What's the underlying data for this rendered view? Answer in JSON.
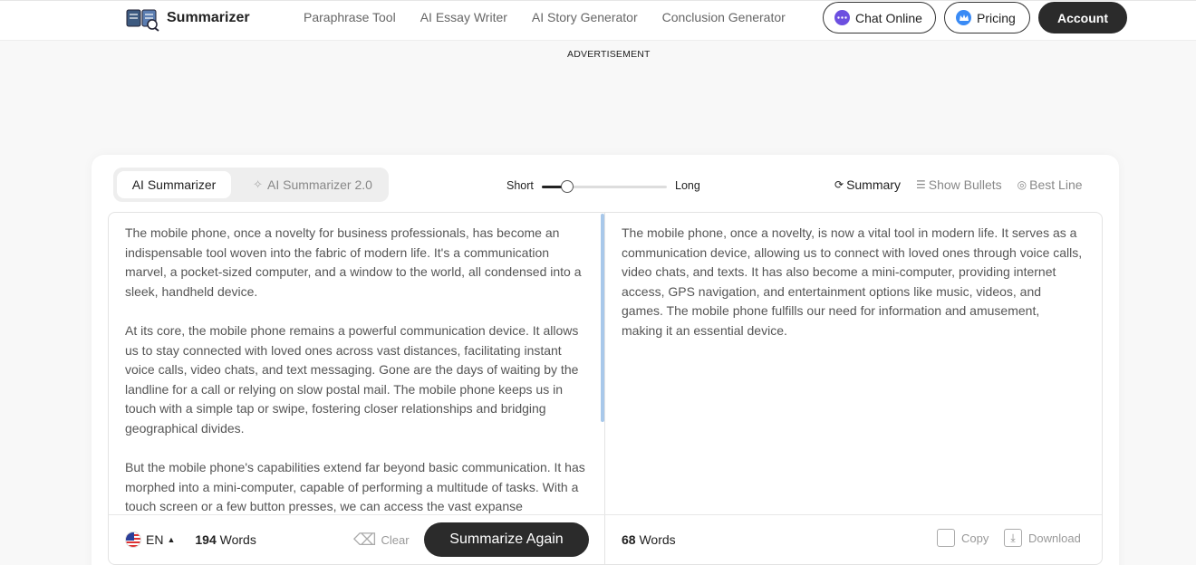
{
  "header": {
    "brand": "Summarizer",
    "nav": [
      "Paraphrase Tool",
      "AI Essay Writer",
      "AI Story Generator",
      "Conclusion Generator"
    ],
    "chat_label": "Chat Online",
    "pricing_label": "Pricing",
    "account_label": "Account"
  },
  "ad_label": "ADVERTISEMENT",
  "tool": {
    "tabs": [
      "AI Summarizer",
      "AI Summarizer 2.0"
    ],
    "length_short": "Short",
    "length_long": "Long",
    "length_level": 0.2,
    "modes": [
      "Summary",
      "Show Bullets",
      "Best Line"
    ],
    "input_paragraphs": [
      "The mobile phone, once a novelty for business professionals, has become an indispensable tool woven into the fabric of modern life. It's a communication marvel, a pocket-sized computer, and a window to the world, all condensed into a sleek, handheld device.",
      "At its core, the mobile phone remains a powerful communication device. It allows us to stay connected with loved ones across vast distances, facilitating instant voice calls, video chats, and text messaging.  Gone are the days of waiting by the landline for a call or relying on slow postal mail. The mobile phone keeps us in touch with a simple tap or swipe, fostering closer relationships and bridging geographical divides.",
      "But the mobile phone's capabilities extend far beyond basic communication. It has morphed into a mini-computer, capable of performing a multitude of tasks. With a touch screen or a few button presses, we can access the vast expanse"
    ],
    "output_text": "The mobile phone, once a novelty, is now a vital tool in modern life. It serves as a communication device, allowing us to connect with loved ones through voice calls, video chats, and texts. It has also become a mini-computer, providing internet access, GPS navigation, and entertainment options like music, videos, and games. The mobile phone fulfills our need for information and amusement, making it an essential device.",
    "language": "EN",
    "input_word_count": "194",
    "output_word_count": "68",
    "words_label": "Words",
    "clear_label": "Clear",
    "summarize_label": "Summarize Again",
    "copy_label": "Copy",
    "download_label": "Download"
  },
  "colors": {
    "primary_dark": "#2b2b2b",
    "chat_dot": "#6c4fe0",
    "pricing_dot": "#3a8bf5",
    "scrollbar": "#a8c8ea"
  }
}
